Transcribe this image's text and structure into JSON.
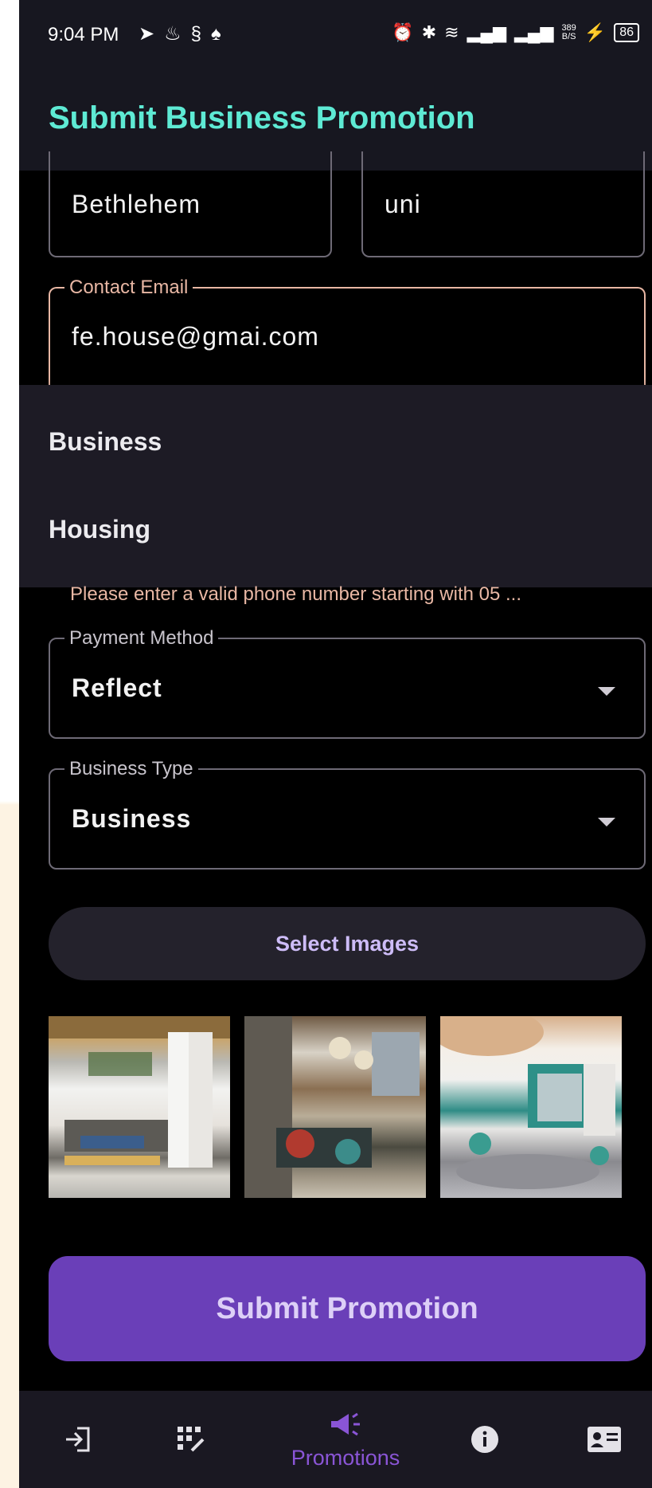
{
  "status_bar": {
    "time": "9:04 PM",
    "left_icons": [
      "send-icon",
      "flame-icon",
      "s-icon",
      "notification-icon"
    ],
    "speed_top": "389",
    "speed_bottom": "B/S",
    "battery": "86"
  },
  "app_bar": {
    "title": "Submit Business Promotion"
  },
  "form": {
    "city_value": "Bethlehem",
    "uni_value": "uni",
    "email_label": "Contact Email",
    "email_value": "fe.house@gmai.com",
    "phone_error": "Please enter a valid phone number starting with 05 ...",
    "payment_label": "Payment Method",
    "payment_value": "Reflect",
    "business_type_label": "Business Type",
    "business_type_value": "Business"
  },
  "dropdown_menu": {
    "items": [
      "Business",
      "Housing"
    ]
  },
  "select_images_label": "Select Images",
  "images": [
    "image-thumbnail-1",
    "image-thumbnail-2",
    "image-thumbnail-3"
  ],
  "submit_label": "Submit Promotion",
  "bottom_nav": {
    "items": [
      {
        "icon": "login-icon",
        "label": ""
      },
      {
        "icon": "dialpad-icon",
        "label": ""
      },
      {
        "icon": "megaphone-icon",
        "label": "Promotions",
        "active": true
      },
      {
        "icon": "info-icon",
        "label": ""
      },
      {
        "icon": "contact-card-icon",
        "label": ""
      }
    ]
  },
  "colors": {
    "title": "#5eead4",
    "accent": "#6a3fb8",
    "active_nav": "#8a55d6",
    "error": "#e8b7a4"
  }
}
